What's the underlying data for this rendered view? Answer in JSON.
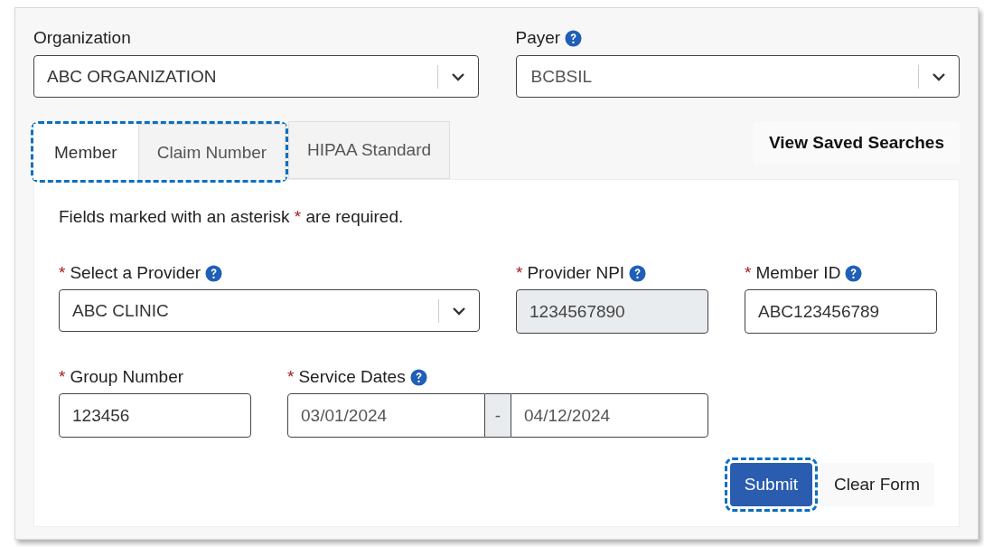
{
  "organization": {
    "label": "Organization",
    "help": false,
    "value": "ABC ORGANIZATION"
  },
  "payer": {
    "label": "Payer",
    "help": true,
    "value": "BCBSIL"
  },
  "tabs": [
    {
      "label": "Member",
      "selected": true,
      "highlighted": true
    },
    {
      "label": "Claim Number",
      "selected": false,
      "highlighted": true
    },
    {
      "label": "HIPAA Standard",
      "selected": false,
      "highlighted": false
    }
  ],
  "saved_searches": "View Saved Searches",
  "required_mark": "*",
  "note": {
    "before": "Fields marked with an asterisk",
    "after": "are required."
  },
  "fields": [
    {
      "kind": "select",
      "label": "Select a Provider",
      "required": true,
      "help": true,
      "disabled": false,
      "value": "ABC CLINIC"
    },
    {
      "kind": "text",
      "label": "Provider NPI",
      "required": true,
      "help": true,
      "disabled": true,
      "value": "1234567890"
    },
    {
      "kind": "text",
      "label": "Member ID",
      "required": true,
      "help": true,
      "disabled": false,
      "value": "ABC123456789"
    },
    {
      "kind": "text",
      "label": "Group Number",
      "required": true,
      "help": false,
      "disabled": false,
      "value": "123456"
    },
    {
      "kind": "daterange",
      "label": "Service Dates",
      "required": true,
      "help": true,
      "disabled": false,
      "start": "03/01/2024",
      "separator": "-",
      "end": "04/12/2024"
    }
  ],
  "buttons": [
    {
      "kind": "primary",
      "label": "Submit",
      "highlighted": true
    },
    {
      "kind": "secondary",
      "label": "Clear Form",
      "highlighted": false
    }
  ]
}
